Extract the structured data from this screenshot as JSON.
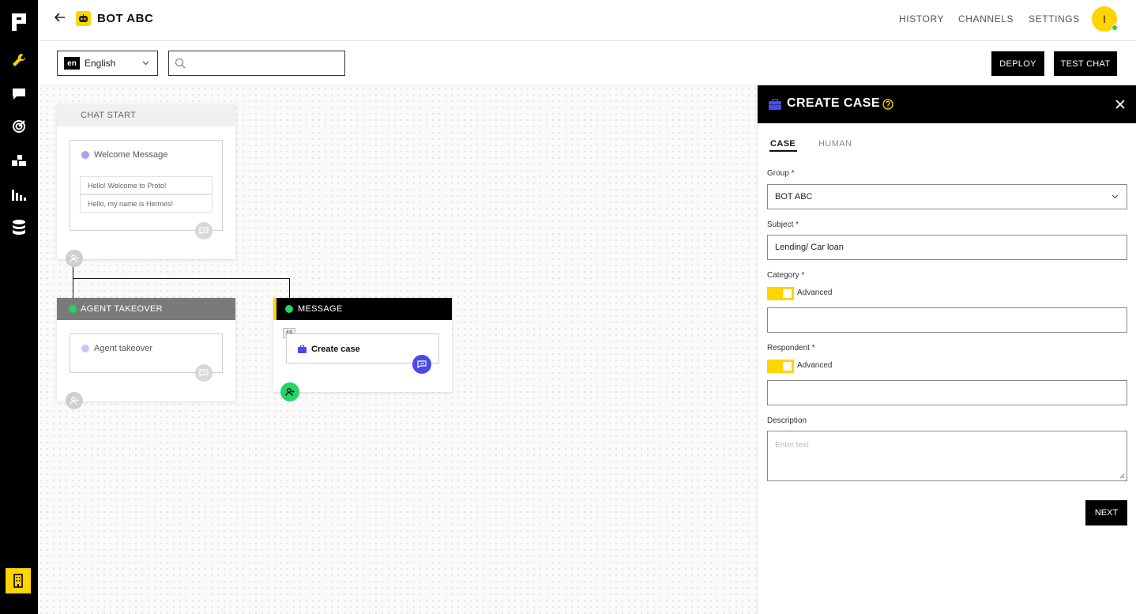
{
  "app": {
    "bot_name": "BOT ABC",
    "avatar_initial": "I"
  },
  "topnav": {
    "history": "HISTORY",
    "channels": "CHANNELS",
    "settings": "SETTINGS"
  },
  "toolbar": {
    "language_code": "en",
    "language_name": "English",
    "search_placeholder": "",
    "deploy_label": "DEPLOY",
    "test_chat_label": "TEST CHAT"
  },
  "sidebar": {
    "icons": [
      "logo-icon",
      "wrench-icon",
      "chat-bubble-icon",
      "target-icon",
      "blocks-icon",
      "bar-chart-icon",
      "database-icon",
      "building-icon"
    ]
  },
  "canvas": {
    "chat_start": {
      "header": "CHAT START",
      "message_title": "Welcome Message",
      "lines": [
        "Hello! Welcome to Proto!",
        "Hello, my name is Hermes!"
      ]
    },
    "agent_takeover": {
      "header": "AGENT TAKEOVER",
      "item_title": "Agent takeover"
    },
    "message": {
      "header": "MESSAGE",
      "badge": "49",
      "item_title": "Create case"
    }
  },
  "panel": {
    "title": "CREATE CASE",
    "tabs": [
      {
        "label": "CASE",
        "active": true
      },
      {
        "label": "HUMAN",
        "active": false
      }
    ],
    "group_label": "Group *",
    "group_value": "BOT ABC",
    "subject_label": "Subject *",
    "subject_value": "Lending/ Car loan",
    "category_label": "Category *",
    "category_toggle_label": "Advanced",
    "category_value": "",
    "respondent_label": "Respondent *",
    "respondent_toggle_label": "Advanced",
    "respondent_value": "",
    "description_label": "Description",
    "description_placeholder": "Enter text",
    "next_label": "NEXT"
  },
  "colors": {
    "accent_yellow": "#ffd400",
    "dark": "#000000",
    "agent_header": "#7a7a7a",
    "create_case_blue": "#4a4ae8",
    "whatsapp_green": "#25d366"
  }
}
